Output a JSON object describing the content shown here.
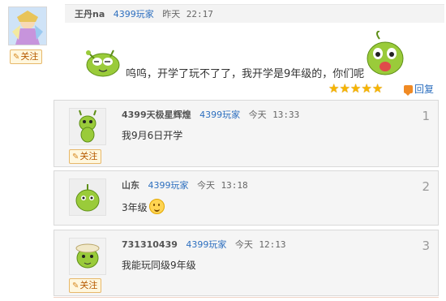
{
  "post": {
    "username": "王丹na",
    "role": "4399玩家",
    "date": "昨天",
    "time": "22:17",
    "text": "呜呜，开学了玩不了了，我开学是9年级的，你们呢",
    "follow_label": "关注",
    "rating": 5,
    "reply_label": "回复"
  },
  "comments": [
    {
      "username": "4399天极星辉煌",
      "role": "4399玩家",
      "date": "今天",
      "time": "13:33",
      "text": "我9月6日开学",
      "floor": "1",
      "follow_label": "关注"
    },
    {
      "username": "山东",
      "role": "4399玩家",
      "date": "今天",
      "time": "13:18",
      "text": "3年级",
      "floor": "2"
    },
    {
      "username": "731310439",
      "role": "4399玩家",
      "date": "今天",
      "time": "12:13",
      "text": "我能玩同级9年级",
      "floor": "3",
      "follow_label": "关注"
    }
  ],
  "colors": {
    "link_blue": "#2d6fbf",
    "star_gold": "#f6b500",
    "follow_border": "#e7b86a"
  }
}
